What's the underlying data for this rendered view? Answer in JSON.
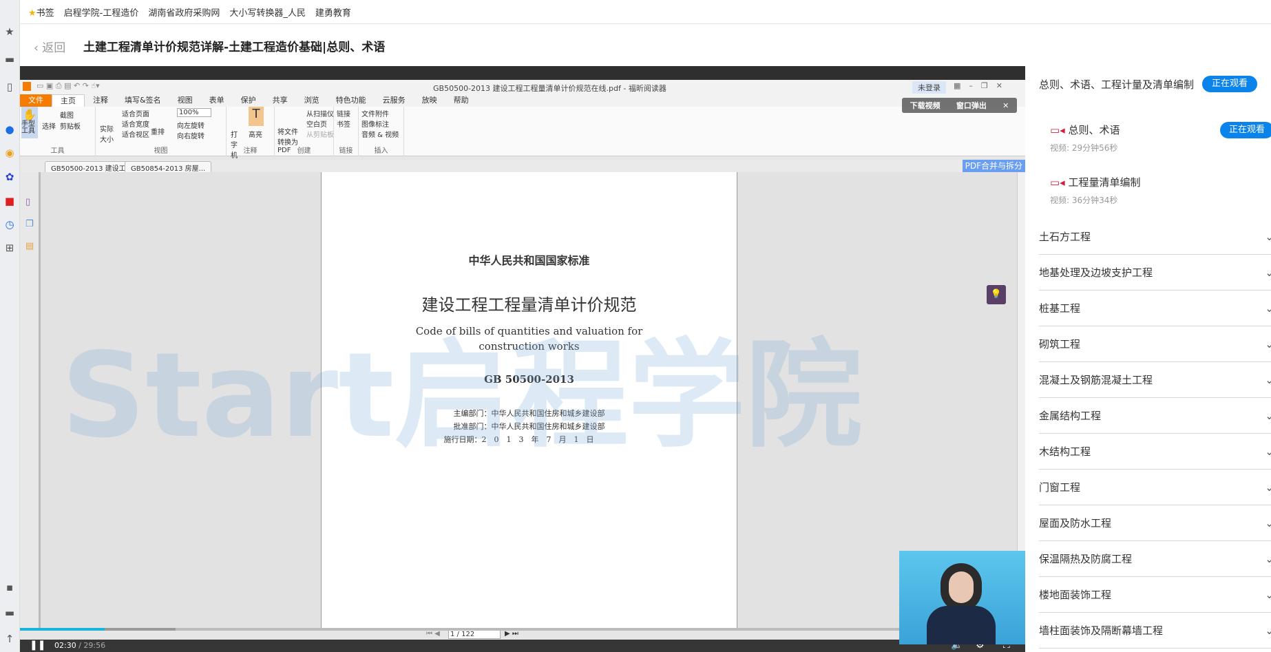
{
  "bookmarks": [
    "书签",
    "启程学院-工程造价",
    "湖南省政府采购网",
    "大小写转换器_人民",
    "建勇教育"
  ],
  "header": {
    "back": "返回",
    "title": "土建工程清单计价规范详解-土建工程造价基础|总则、术语"
  },
  "pdf_app": {
    "window_title": "GB50500-2013 建设工程工程量清单计价规范在线.pdf - 福昕阅读器",
    "login": "未登录",
    "ribbon_tabs": [
      "文件",
      "主页",
      "注释",
      "填写&签名",
      "视图",
      "表单",
      "保护",
      "共享",
      "浏览",
      "特色功能",
      "云服务",
      "放映",
      "帮助"
    ],
    "groups": {
      "tools": "工具",
      "view": "视图",
      "annot": "注释",
      "create": "创建",
      "link": "链接",
      "insert": "插入"
    },
    "buttons": {
      "hand": "手型工具",
      "select": "选择",
      "snapshot": "截图",
      "clipboard": "剪贴板",
      "actual": "实际大小",
      "fit_page": "适合页面",
      "fit_width": "适合宽度",
      "fit_visible": "适合视区",
      "reflow": "重排",
      "zoom": "100%",
      "rotate_left": "向左旋转",
      "rotate_right": "向右旋转",
      "typewriter": "打字机",
      "highlight": "高亮",
      "to_pdf": "将文件转换为PDF",
      "from_scanner": "从扫描仪",
      "blank": "空白页",
      "from_clip": "从剪贴板",
      "link": "链接",
      "bookmark": "书签",
      "attach": "文件附件",
      "image": "图像标注",
      "av": "音频 & 视频"
    },
    "doc_tabs": [
      "GB50500-2013 建设工...",
      "GB50854-2013 房屋..."
    ],
    "pdf_merge": "PDF合并与拆分",
    "page_indicator": "1 / 122"
  },
  "pdf_page": {
    "l1": "中华人民共和国国家标准",
    "l2": "建设工程工程量清单计价规范",
    "l3": "Code of bills of quantities and valuation for",
    "l4": "construction works",
    "l5": "GB 50500-2013",
    "l6": "主编部门：中华人民共和国住房和城乡建设部",
    "l7": "批准部门：中华人民共和国住房和城乡建设部",
    "l8": "施行日期：2　0　1　3　年　7　月　1　日"
  },
  "watermark": "Start启程学院",
  "popup": {
    "download": "下载视频",
    "popout": "窗口弹出"
  },
  "player": {
    "current": "02:30",
    "total": "29:56",
    "progress_percent": 8.4
  },
  "sidebar": {
    "chapter": "总则、术语、工程计量及清单编制",
    "chapter_badge": "正在观看",
    "lessons": [
      {
        "title": "总则、术语",
        "meta": "视频: 29分钟56秒",
        "badge": "正在观看"
      },
      {
        "title": "工程量清单编制",
        "meta": "视频: 36分钟34秒"
      }
    ],
    "sections": [
      "土石方工程",
      "地基处理及边坡支护工程",
      "桩基工程",
      "砌筑工程",
      "混凝土及钢筋混凝土工程",
      "金属结构工程",
      "木结构工程",
      "门窗工程",
      "屋面及防水工程",
      "保温隔热及防腐工程",
      "楼地面装饰工程",
      "墙柱面装饰及隔断幕墙工程"
    ]
  },
  "colors": {
    "accent": "#0a84ea",
    "progress": "#18b3d8",
    "file_tab": "#f57c00"
  }
}
